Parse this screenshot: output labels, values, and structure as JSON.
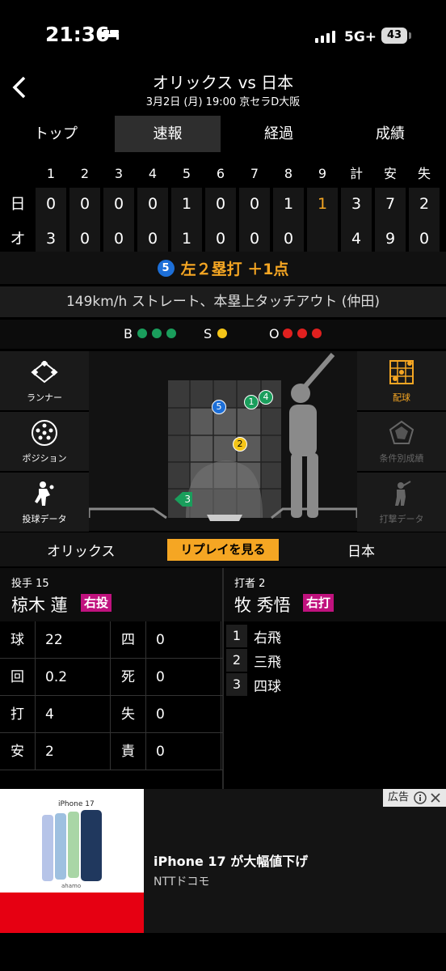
{
  "status": {
    "time": "21:36",
    "network": "5G+",
    "battery": "43"
  },
  "header": {
    "title": "オリックス vs 日本",
    "subtitle": "3月2日 (月) 19:00 京セラD大阪"
  },
  "tabs": [
    {
      "label": "トップ"
    },
    {
      "label": "速報"
    },
    {
      "label": "経過"
    },
    {
      "label": "成績"
    }
  ],
  "scoreboard": {
    "innings": [
      "1",
      "2",
      "3",
      "4",
      "5",
      "6",
      "7",
      "8",
      "9",
      "計",
      "安",
      "失"
    ],
    "rows": [
      {
        "team": "日",
        "cells": [
          "0",
          "0",
          "0",
          "0",
          "1",
          "0",
          "0",
          "1",
          "1",
          "3",
          "7",
          "2"
        ]
      },
      {
        "team": "オ",
        "cells": [
          "3",
          "0",
          "0",
          "0",
          "1",
          "0",
          "0",
          "0",
          "",
          "4",
          "9",
          "0"
        ]
      }
    ]
  },
  "play": {
    "batter_num": "5",
    "text": "左２塁打 ＋1点"
  },
  "detail": "149km/h ストレート、本塁上タッチアウト (仲田)",
  "count": {
    "b_label": "B",
    "s_label": "S",
    "o_label": "O"
  },
  "left_menu": [
    {
      "label": "ランナー"
    },
    {
      "label": "ポジション"
    },
    {
      "label": "投球データ"
    }
  ],
  "right_menu": [
    {
      "label": "配球"
    },
    {
      "label": "条件別成績"
    },
    {
      "label": "打撃データ"
    }
  ],
  "pitches": [
    {
      "n": "1"
    },
    {
      "n": "2"
    },
    {
      "n": "3"
    },
    {
      "n": "4"
    },
    {
      "n": "5"
    }
  ],
  "teambar": {
    "left": "オリックス",
    "replay": "リプレイを見る",
    "right": "日本"
  },
  "pitcher": {
    "role": "投手 15",
    "name": "椋木 蓮",
    "hand": "右投"
  },
  "batter": {
    "role": "打者 2",
    "name": "牧 秀悟",
    "hand": "右打"
  },
  "stats": [
    {
      "l1": "球",
      "v1": "22",
      "l2": "四",
      "v2": "0"
    },
    {
      "l1": "回",
      "v1": "0.2",
      "l2": "死",
      "v2": "0"
    },
    {
      "l1": "打",
      "v1": "4",
      "l2": "失",
      "v2": "0"
    },
    {
      "l1": "安",
      "v1": "2",
      "l2": "責",
      "v2": "0"
    }
  ],
  "results": [
    {
      "n": "1",
      "t": "右飛"
    },
    {
      "n": "2",
      "t": "三飛"
    },
    {
      "n": "3",
      "t": "四球"
    }
  ],
  "ad": {
    "label": "広告",
    "title": "iPhone 17 が大幅値下げ",
    "source": "NTTドコモ",
    "product": "iPhone 17",
    "brand": "ahamo"
  }
}
